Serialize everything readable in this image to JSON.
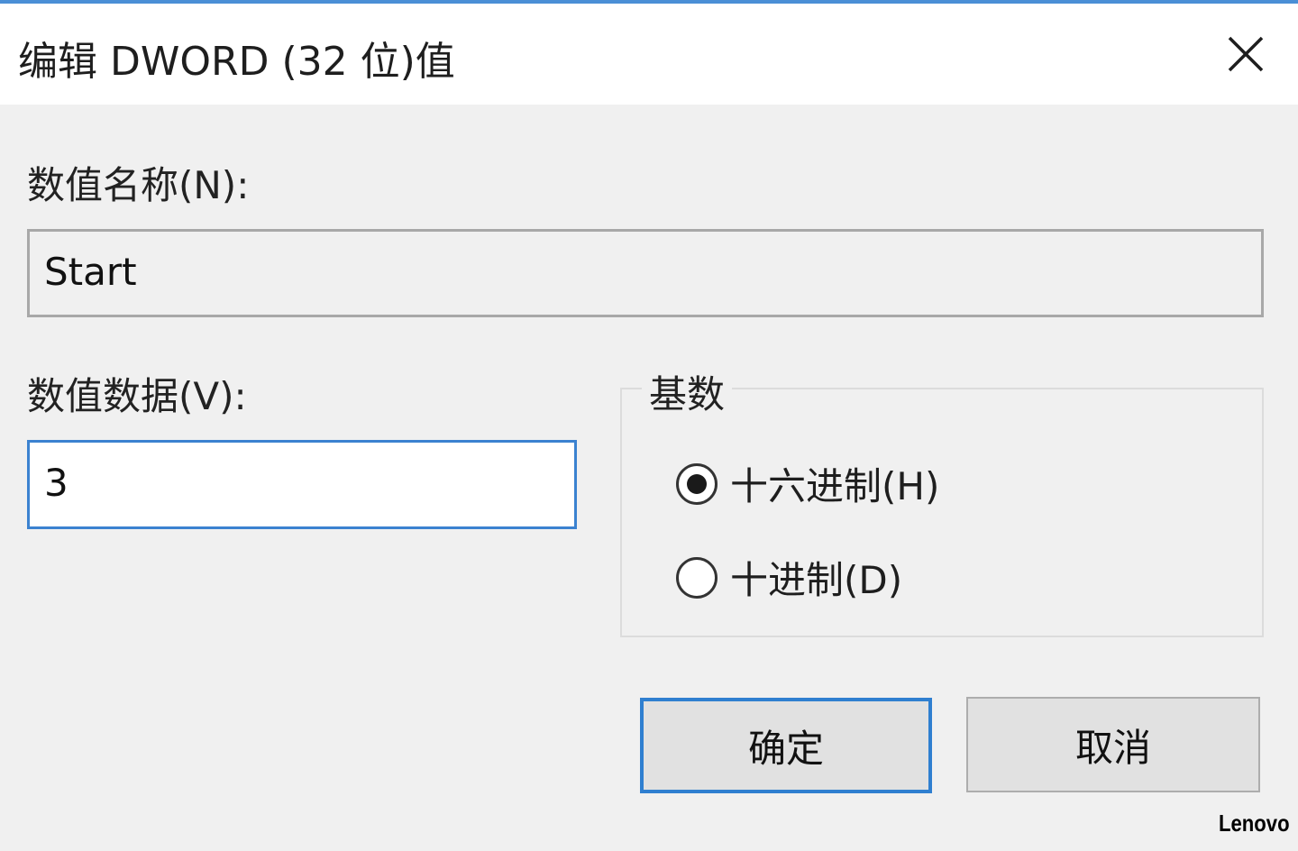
{
  "window": {
    "title": "编辑 DWORD (32 位)值",
    "close_icon": "close-icon",
    "accent_color": "#3b82d0"
  },
  "value_name": {
    "label": "数值名称(N):",
    "value": "Start"
  },
  "value_data": {
    "label": "数值数据(V):",
    "value": "3"
  },
  "base": {
    "label": "基数",
    "options": [
      {
        "label": "十六进制(H)",
        "selected": true
      },
      {
        "label": "十进制(D)",
        "selected": false
      }
    ]
  },
  "buttons": {
    "ok": "确定",
    "cancel": "取消"
  },
  "watermark": "Lenovo"
}
